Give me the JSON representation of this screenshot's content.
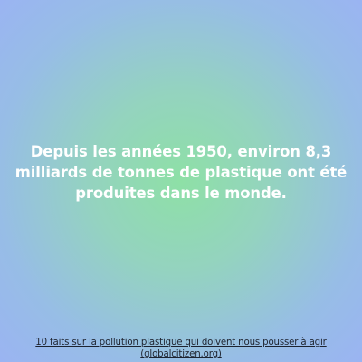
{
  "card": {
    "fact_text": "Depuis les années 1950, environ 8,3 milliards de tonnes de plastique ont été produites dans le monde.",
    "source_title": "10 faits sur la pollution plastique qui doivent nous pousser à agir",
    "source_site": "(globalcitizen.org)"
  },
  "colors": {
    "center": "#8ee0a6",
    "edge": "#9ab4f2",
    "text": "#ffffff",
    "link": "#1e2430"
  }
}
